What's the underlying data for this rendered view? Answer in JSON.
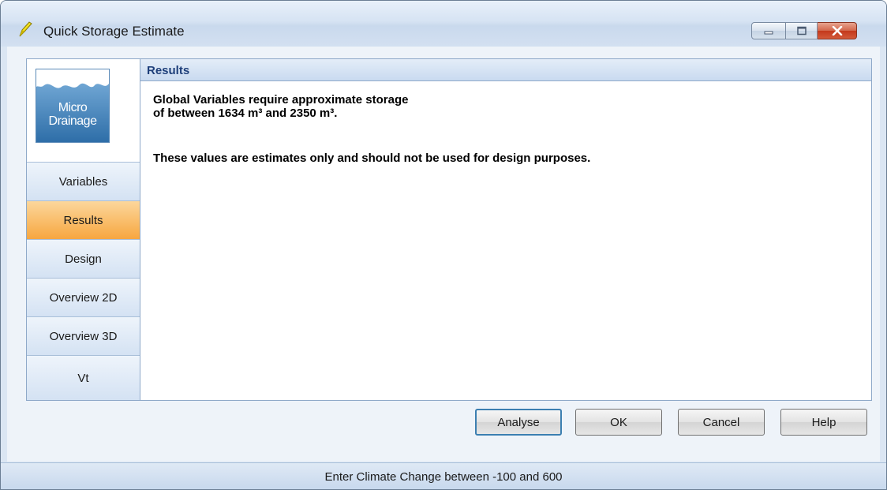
{
  "window": {
    "title": "Quick Storage Estimate"
  },
  "logo": {
    "line1": "Micro",
    "line2": "Drainage"
  },
  "sidebar": {
    "items": [
      {
        "label": "Variables",
        "active": false
      },
      {
        "label": "Results",
        "active": true
      },
      {
        "label": "Design",
        "active": false
      },
      {
        "label": "Overview 2D",
        "active": false
      },
      {
        "label": "Overview 3D",
        "active": false
      },
      {
        "label": "Vt",
        "active": false
      }
    ]
  },
  "results": {
    "header": "Results",
    "line1": "Global Variables require approximate storage",
    "line2": "of between 1634 m³ and 2350 m³.",
    "note": "These values are estimates only and should not be used for design purposes."
  },
  "buttons": {
    "analyse": "Analyse",
    "ok": "OK",
    "cancel": "Cancel",
    "help": "Help"
  },
  "status": {
    "text": "Enter Climate Change between -100 and 600"
  },
  "colors": {
    "active_tab": "#f7a63f",
    "close_button": "#c3381b",
    "header_text": "#1e3f7a"
  },
  "icons": {
    "title": "pencil-icon",
    "minimize": "minimize-icon",
    "maximize": "maximize-icon",
    "close": "close-icon"
  }
}
